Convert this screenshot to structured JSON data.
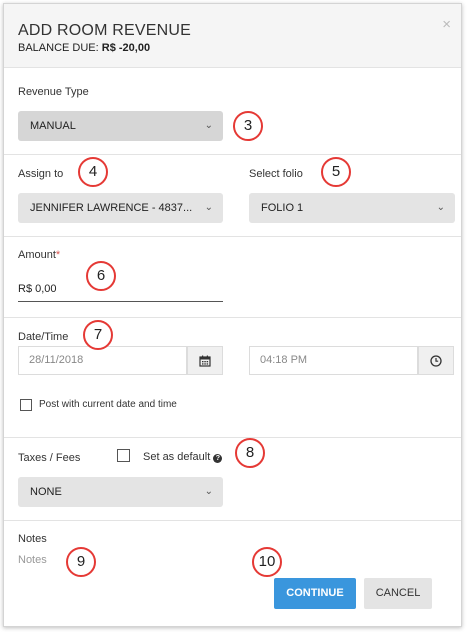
{
  "header": {
    "title": "ADD ROOM REVENUE",
    "balance_label": "BALANCE DUE:",
    "balance_value": "R$ -20,00",
    "close_symbol": "×"
  },
  "revenue_type": {
    "label": "Revenue Type",
    "value": "MANUAL"
  },
  "assign_to": {
    "label": "Assign to",
    "value": "JENNIFER LAWRENCE - 4837..."
  },
  "select_folio": {
    "label": "Select folio",
    "value": "FOLIO 1"
  },
  "amount": {
    "label": "Amount",
    "required_mark": "*",
    "value": "R$ 0,00"
  },
  "datetime": {
    "label": "Date/Time",
    "date_placeholder": "28/11/2018",
    "time_placeholder": "04:18 PM",
    "post_current_label": "Post with current date and time"
  },
  "taxes": {
    "label": "Taxes / Fees",
    "default_label": "Set as default",
    "help_symbol": "?",
    "value": "NONE"
  },
  "notes": {
    "label": "Notes",
    "placeholder": "Notes"
  },
  "buttons": {
    "continue": "CONTINUE",
    "cancel": "CANCEL"
  },
  "callouts": [
    "3",
    "4",
    "5",
    "6",
    "7",
    "8",
    "9",
    "10"
  ],
  "colors": {
    "primary": "#3a96dd",
    "callout_border": "#e53935",
    "required": "#d9534f"
  }
}
